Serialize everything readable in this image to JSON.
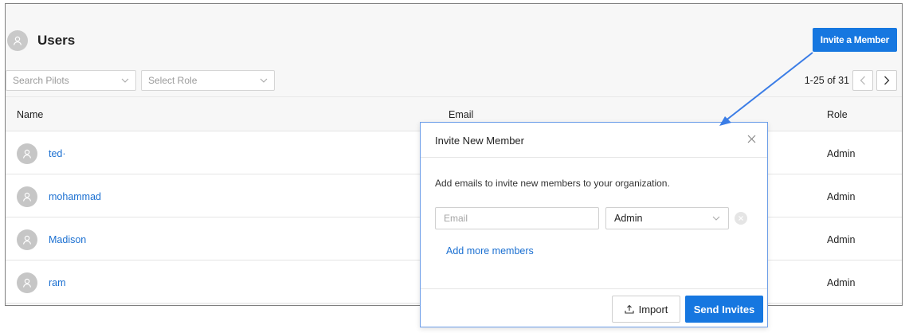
{
  "header": {
    "title": "Users",
    "invite_button": "Invite a Member"
  },
  "filters": {
    "search_placeholder": "Search Pilots",
    "role_placeholder": "Select Role"
  },
  "pagination": {
    "range": "1-25 of 31"
  },
  "table": {
    "columns": [
      "Name",
      "Email",
      "Role"
    ],
    "rows": [
      {
        "name": "ted·",
        "role": "Admin"
      },
      {
        "name": "mohammad",
        "role": "Admin"
      },
      {
        "name": "Madison",
        "role": "Admin"
      },
      {
        "name": "ram",
        "role": "Admin"
      }
    ]
  },
  "modal": {
    "title": "Invite New Member",
    "description": "Add emails to invite new members to your organization.",
    "email_placeholder": "Email",
    "role_value": "Admin",
    "add_more": "Add more members",
    "import_button": "Import",
    "send_button": "Send Invites"
  },
  "colors": {
    "accent": "#1677e0",
    "link": "#1a6fd1",
    "annotation_arrow": "#3b7de6"
  },
  "icons": {
    "avatar": "user-icon",
    "close": "close-icon",
    "import": "upload-icon",
    "remove": "remove-circle-icon",
    "chevron": "chevron-down-icon"
  }
}
